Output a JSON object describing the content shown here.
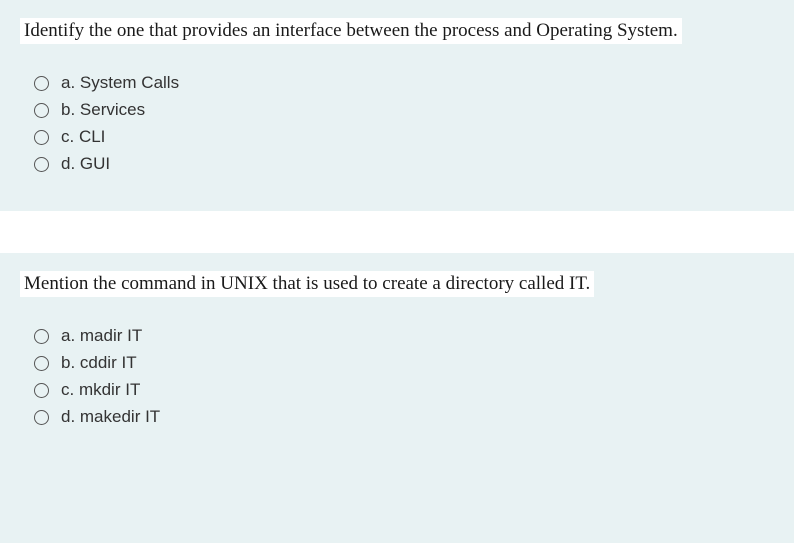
{
  "questions": [
    {
      "text": "Identify the one that provides an interface between the process and Operating System.",
      "options": [
        {
          "label": "a. System Calls"
        },
        {
          "label": "b. Services"
        },
        {
          "label": "c. CLI"
        },
        {
          "label": "d. GUI"
        }
      ]
    },
    {
      "text": "Mention the command in UNIX that is used to create a directory called IT.",
      "options": [
        {
          "label": "a. madir IT"
        },
        {
          "label": "b. cddir IT"
        },
        {
          "label": "c. mkdir IT"
        },
        {
          "label": "d. makedir IT"
        }
      ]
    }
  ]
}
